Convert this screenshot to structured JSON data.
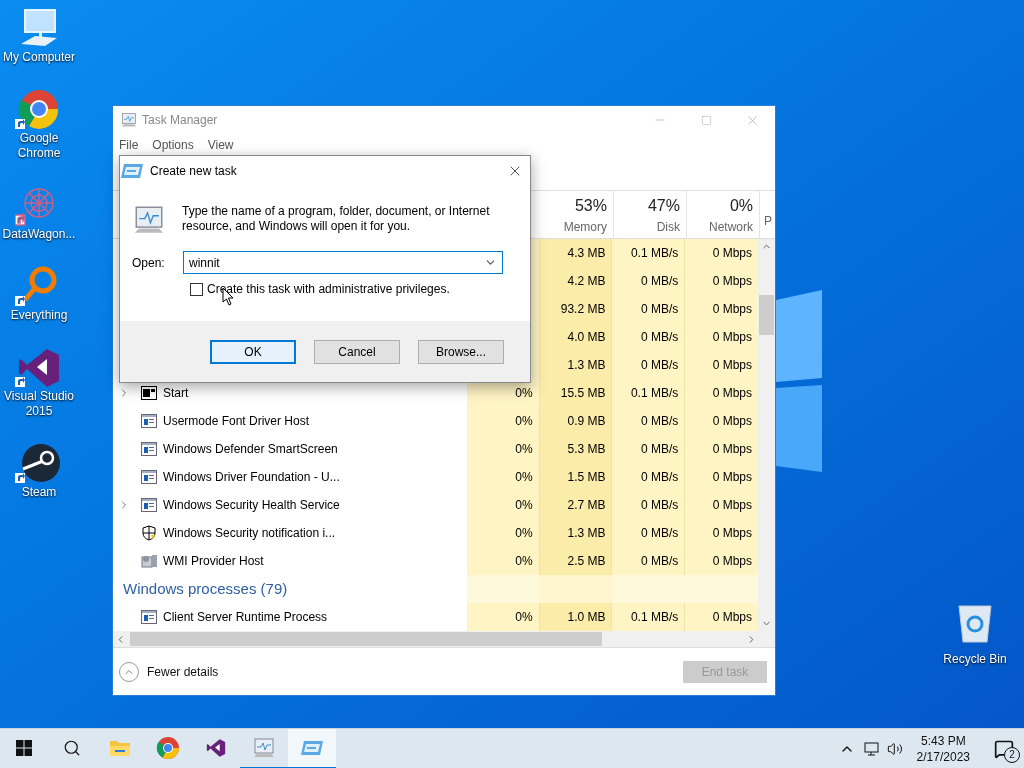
{
  "desktop_icons": [
    {
      "kind": "computer",
      "label": "My Computer"
    },
    {
      "kind": "chrome",
      "label": "Google Chrome"
    },
    {
      "kind": "datawagon",
      "label": "DataWagon..."
    },
    {
      "kind": "everything",
      "label": "Everything"
    },
    {
      "kind": "vs",
      "label": "Visual Studio 2015"
    },
    {
      "kind": "steam",
      "label": "Steam"
    }
  ],
  "recycle_bin": {
    "label": "Recycle Bin"
  },
  "task_manager": {
    "title": "Task Manager",
    "menu": [
      "File",
      "Options",
      "View"
    ],
    "columns": [
      {
        "percent": "53%",
        "label": "Memory"
      },
      {
        "percent": "47%",
        "label": "Disk"
      },
      {
        "percent": "0%",
        "label": "Network"
      }
    ],
    "column_cut": "P",
    "rows": [
      {
        "memory": "4.3 MB",
        "disk": "0.1 MB/s",
        "network": "0 Mbps"
      },
      {
        "memory": "4.2 MB",
        "disk": "0 MB/s",
        "network": "0 Mbps"
      },
      {
        "memory": "93.2 MB",
        "disk": "0 MB/s",
        "network": "0 Mbps"
      },
      {
        "memory": "4.0 MB",
        "disk": "0 MB/s",
        "network": "0 Mbps"
      },
      {
        "memory": "1.3 MB",
        "disk": "0 MB/s",
        "network": "0 Mbps"
      },
      {
        "kind": "window",
        "expandable": true,
        "name": "Start",
        "cpu": "0%",
        "memory": "15.5 MB",
        "disk": "0.1 MB/s",
        "network": "0 Mbps"
      },
      {
        "kind": "app",
        "expandable": false,
        "name": "Usermode Font Driver Host",
        "cpu": "0%",
        "memory": "0.9 MB",
        "disk": "0 MB/s",
        "network": "0 Mbps"
      },
      {
        "kind": "app",
        "expandable": false,
        "name": "Windows Defender SmartScreen",
        "cpu": "0%",
        "memory": "5.3 MB",
        "disk": "0 MB/s",
        "network": "0 Mbps"
      },
      {
        "kind": "app",
        "expandable": false,
        "name": "Windows Driver Foundation - U...",
        "cpu": "0%",
        "memory": "1.5 MB",
        "disk": "0 MB/s",
        "network": "0 Mbps"
      },
      {
        "kind": "app",
        "expandable": true,
        "name": "Windows Security Health Service",
        "cpu": "0%",
        "memory": "2.7 MB",
        "disk": "0 MB/s",
        "network": "0 Mbps"
      },
      {
        "kind": "shield",
        "expandable": false,
        "name": "Windows Security notification i...",
        "cpu": "0%",
        "memory": "1.3 MB",
        "disk": "0 MB/s",
        "network": "0 Mbps"
      },
      {
        "kind": "wmi",
        "expandable": false,
        "name": "WMI Provider Host",
        "cpu": "0%",
        "memory": "2.5 MB",
        "disk": "0 MB/s",
        "network": "0 Mbps"
      }
    ],
    "section": "Windows processes (79)",
    "cut_row": {
      "kind": "app",
      "name": "Client Server Runtime Process",
      "cpu": "0%",
      "memory": "1.0 MB",
      "disk": "0.1 MB/s",
      "network": "0 Mbps"
    },
    "fewer_details": "Fewer details",
    "end_task": {
      "label": "End task",
      "disabled": true
    }
  },
  "dialog": {
    "title": "Create new task",
    "message": "Type the name of a program, folder, document, or Internet resource, and Windows will open it for you.",
    "open_label": "Open:",
    "value": "winnit",
    "checkbox": {
      "label": "Create this task with administrative privileges.",
      "checked": false
    },
    "buttons": [
      {
        "label": "OK",
        "default": true
      },
      {
        "label": "Cancel",
        "default": false
      },
      {
        "label": "Browse...",
        "default": false
      }
    ]
  },
  "taskbar": {
    "apps": [
      {
        "kind": "start",
        "running": false,
        "focused": false
      },
      {
        "kind": "search",
        "running": false,
        "focused": false
      },
      {
        "kind": "explorer",
        "running": false,
        "focused": false
      },
      {
        "kind": "chrome",
        "running": false,
        "focused": false
      },
      {
        "kind": "vs",
        "running": false,
        "focused": false
      },
      {
        "kind": "taskmgr",
        "running": true,
        "focused": false
      },
      {
        "kind": "run",
        "running": true,
        "focused": true
      }
    ],
    "time": "5:43 PM",
    "date": "2/17/2023",
    "notifications": "2"
  }
}
